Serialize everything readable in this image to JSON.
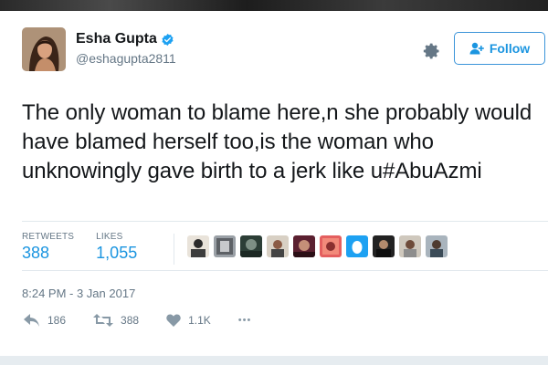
{
  "user": {
    "name": "Esha Gupta",
    "handle": "@eshagupta2811"
  },
  "header": {
    "follow_label": "Follow"
  },
  "tweet": {
    "text": "The only woman to blame here,n she probably would have blamed herself too,is the woman who unknowingly gave birth to a jerk like u#AbuAzmi",
    "timestamp": "8:24 PM - 3 Jan 2017"
  },
  "stats": {
    "retweets_label": "RETWEETS",
    "retweets_value": "388",
    "likes_label": "LIKES",
    "likes_value": "1,055"
  },
  "actions": {
    "reply_count": "186",
    "retweet_count": "388",
    "like_count": "1.1K",
    "more_label": "•••"
  },
  "colors": {
    "accent": "#1b95e0",
    "text_primary": "#14171a",
    "text_secondary": "#657786",
    "divider": "#e1e8ed"
  },
  "icons": [
    "verified-badge-icon",
    "gear-icon",
    "follow-user-icon",
    "reply-icon",
    "retweet-icon",
    "heart-icon",
    "more-icon"
  ]
}
